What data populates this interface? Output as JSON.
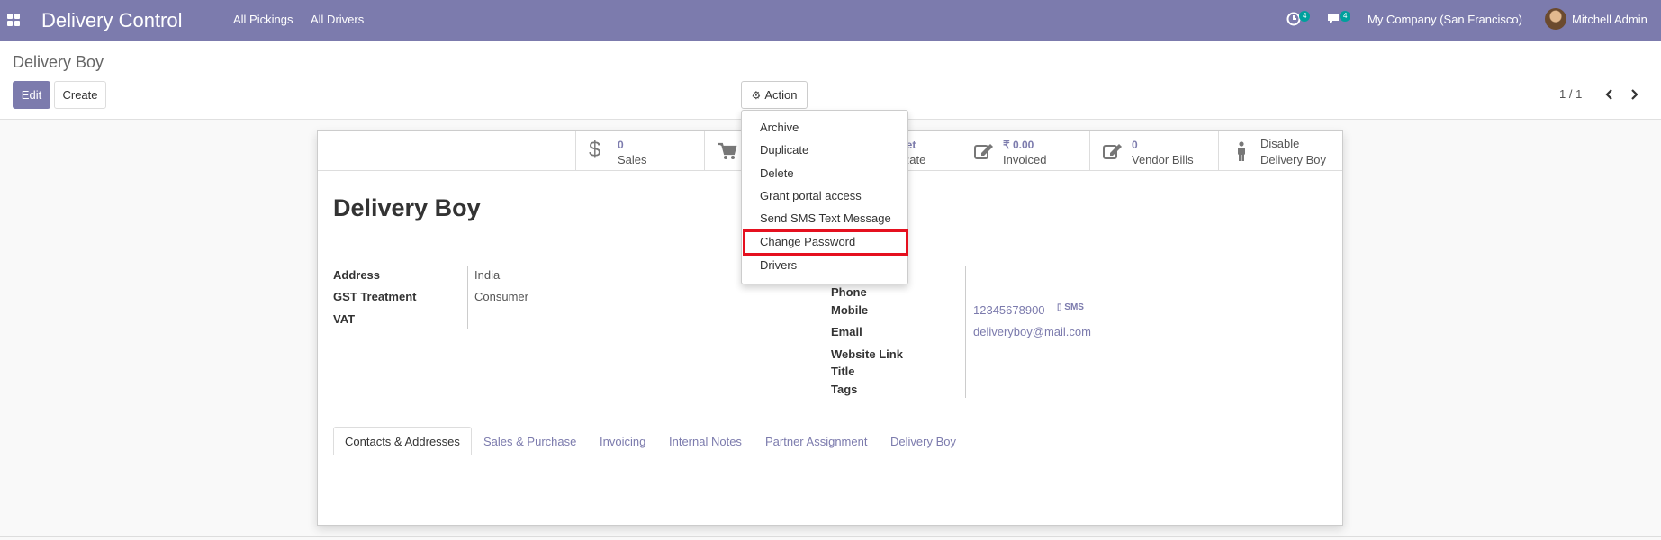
{
  "navbar": {
    "app_title": "Delivery Control",
    "menus": [
      "All Pickings",
      "All Drivers"
    ],
    "activity_badge": "4",
    "messages_badge": "4",
    "company": "My Company (San Francisco)",
    "user": "Mitchell Admin"
  },
  "control_panel": {
    "breadcrumb": "Delivery Boy",
    "edit_label": "Edit",
    "create_label": "Create",
    "action_label": "Action",
    "pager": "1 / 1"
  },
  "stat_buttons": {
    "sales": {
      "value": "0",
      "label": "Sales"
    },
    "rate": {
      "value": "a yet",
      "label": "e Rate"
    },
    "invoiced": {
      "value": "₹ 0.00",
      "label": "Invoiced"
    },
    "vendor_bills": {
      "value": "0",
      "label": "Vendor Bills"
    },
    "disable": {
      "line1": "Disable",
      "line2": "Delivery Boy"
    }
  },
  "form": {
    "name": "Delivery Boy",
    "left_fields": [
      {
        "label": "Address",
        "value": "India"
      },
      {
        "label": "GST Treatment",
        "value": "Consumer"
      },
      {
        "label": "VAT",
        "value": ""
      }
    ],
    "right_fields": {
      "phone_label": "Phone",
      "mobile_label": "Mobile",
      "mobile_value": "12345678900",
      "sms_label": "SMS",
      "email_label": "Email",
      "email_value": "deliveryboy@mail.com",
      "website_label": "Website Link",
      "title_label": "Title",
      "tags_label": "Tags"
    }
  },
  "tabs": [
    "Contacts & Addresses",
    "Sales & Purchase",
    "Invoicing",
    "Internal Notes",
    "Partner Assignment",
    "Delivery Boy"
  ],
  "action_menu": {
    "items": [
      "Archive",
      "Duplicate",
      "Delete",
      "Grant portal access",
      "Send SMS Text Message",
      "Change Password",
      "Drivers"
    ],
    "highlighted": "Change Password",
    "highlight_color": "#e5101f"
  },
  "colors": {
    "navbar": "#7c7bad",
    "accent": "#7c7bad",
    "badge": "#00a09d"
  }
}
